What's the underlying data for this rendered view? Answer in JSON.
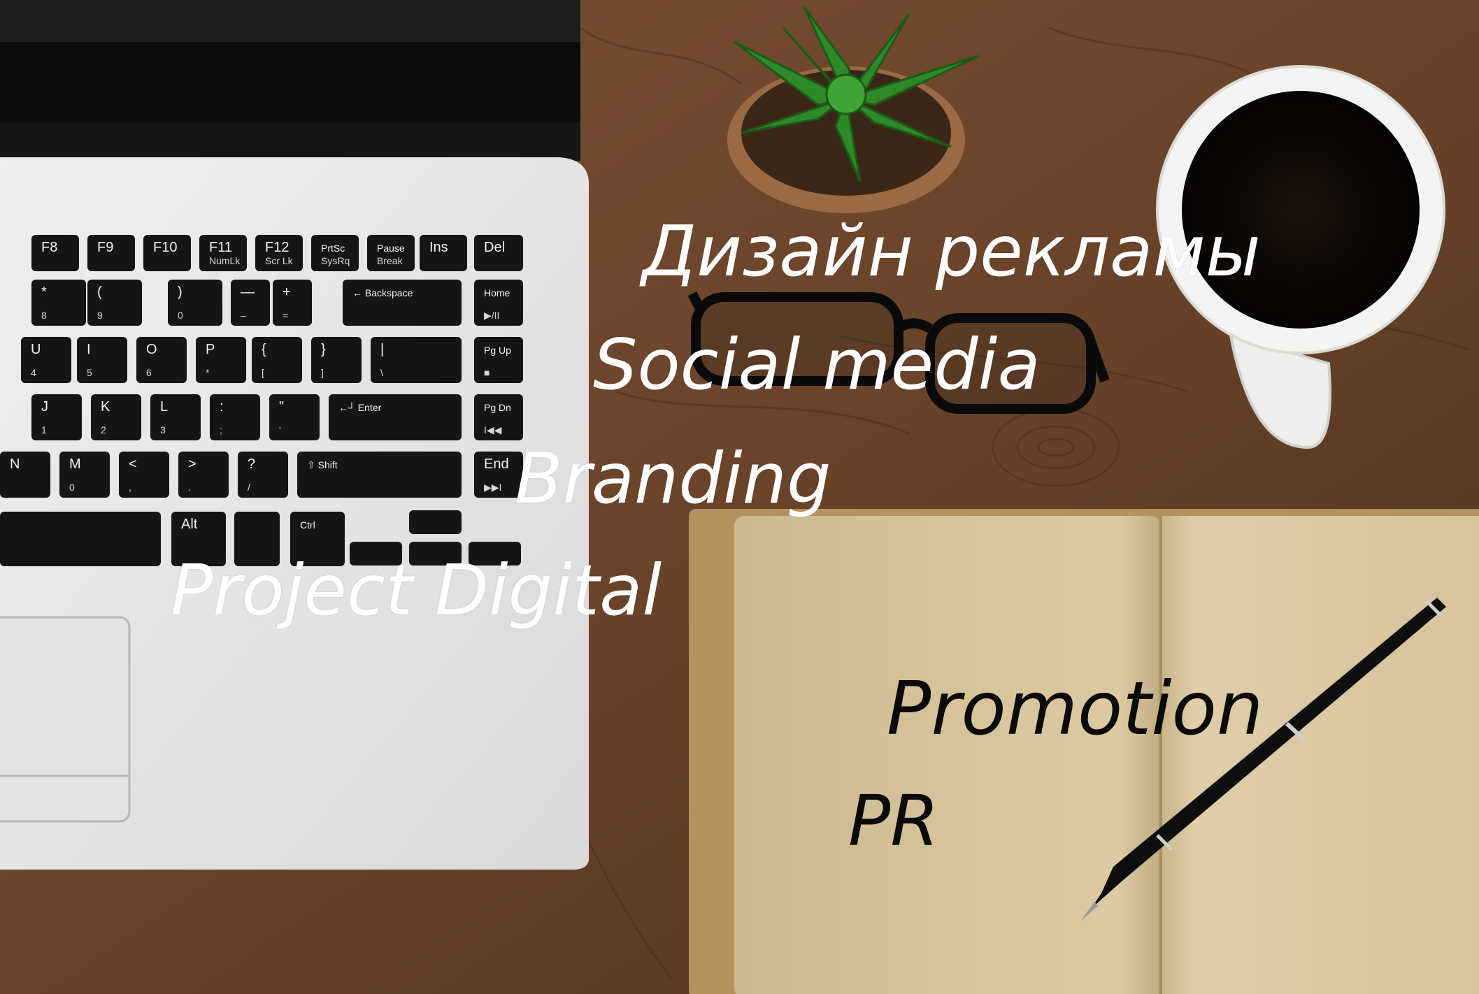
{
  "overlay_words": {
    "w1": "Дизайн рекламы",
    "w2": "Social media",
    "w3": "Branding",
    "w4": "Project Digital",
    "w5": "Promotion",
    "w6": "PR"
  },
  "keyboard": {
    "row1": [
      "F8",
      "F9",
      "F10",
      "F11",
      "F12",
      "PrtSc",
      "Pause",
      "Ins",
      "Del"
    ],
    "row1_sub": [
      "",
      "",
      "",
      "NumLk",
      "Scr Lk",
      "SysRq",
      "Break",
      "",
      ""
    ],
    "row2": [
      "*",
      "(",
      ")",
      "—",
      "+",
      "← Backspace",
      "Home"
    ],
    "row2_sub": [
      "8",
      "9",
      "0",
      "–",
      "=",
      "",
      "▶/II"
    ],
    "row3": [
      "U",
      "I",
      "O",
      "P",
      "{",
      "}",
      "|",
      "Pg Up"
    ],
    "row3_sub": [
      "4",
      "5",
      "6",
      "*",
      "[",
      "]",
      "\\",
      "■"
    ],
    "row4": [
      "J",
      "K",
      "L",
      ":",
      "\"",
      "←┘ Enter",
      "Pg Dn"
    ],
    "row4_sub": [
      "1",
      "2",
      "3",
      ";",
      "'",
      "",
      "I◀◀"
    ],
    "row5": [
      "N",
      "M",
      "<",
      ">",
      "?",
      "⇧ Shift",
      "End"
    ],
    "row5_sub": [
      "",
      "0",
      ",",
      ".",
      "/",
      "",
      "▶▶I"
    ],
    "row6": [
      "Alt",
      "Ctrl"
    ]
  },
  "colors": {
    "wood": "#6b4428",
    "wood_dark": "#3d2615",
    "laptop_body": "#e9e9ea",
    "key": "#151515",
    "notebook_page": "#d8c59c",
    "notebook_cover": "#b89866",
    "cup": "#f3f3f1",
    "coffee": "#120b07",
    "plant": "#2f8a2a"
  }
}
